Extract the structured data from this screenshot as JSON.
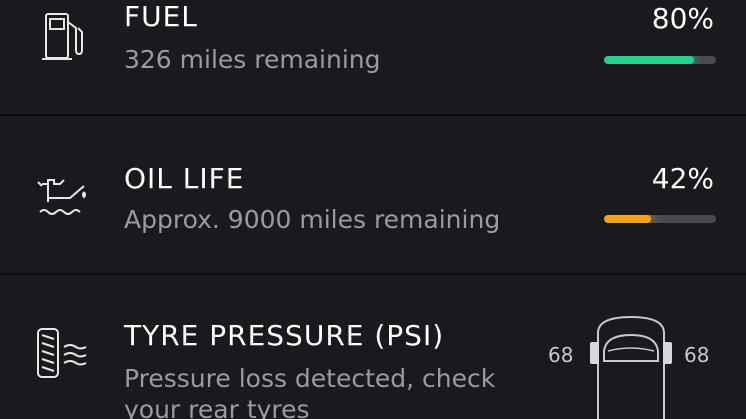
{
  "colors": {
    "background": "#1a1a1e",
    "fuel_bar": "#22d58a",
    "oil_bar": "#f5a213",
    "track": "#4a4a50",
    "subtitle_text": "#9a9aa0"
  },
  "fuel": {
    "title": "FUEL",
    "subtitle": "326 miles remaining",
    "percent_label": "80%",
    "level": 0.8,
    "icon": "fuel-pump-icon"
  },
  "oil": {
    "title": "OIL LIFE",
    "subtitle": "Approx. 9000 miles remaining",
    "percent_label": "42%",
    "level": 0.42,
    "icon": "oil-can-icon"
  },
  "tyre": {
    "title": "TYRE PRESSURE (PSI)",
    "subtitle": "Pressure loss detected, check your rear tyres",
    "front_left_psi": "68",
    "front_right_psi": "68",
    "icon": "tyre-pressure-icon"
  }
}
